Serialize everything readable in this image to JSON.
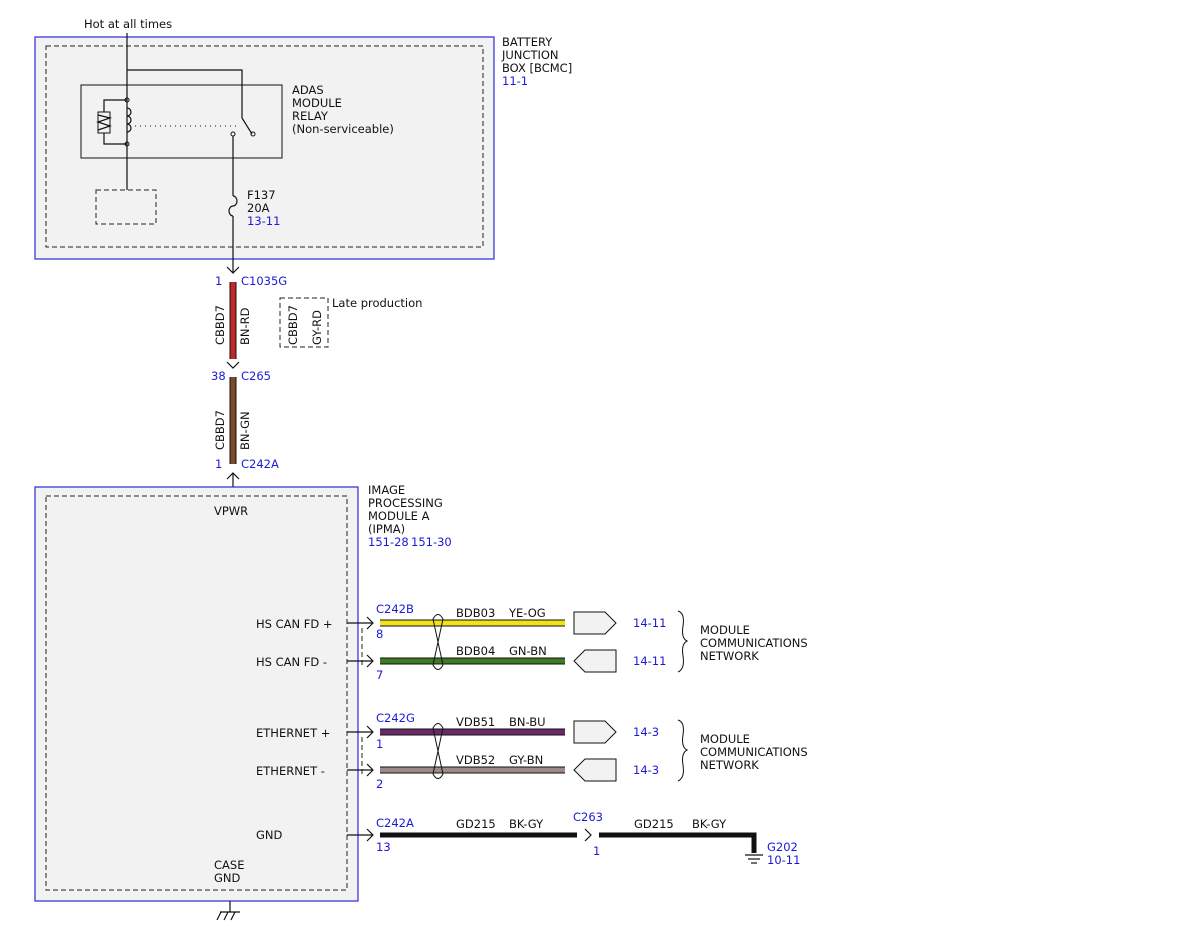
{
  "top": {
    "hot_label": "Hot at all times",
    "bjb_lines": [
      "BATTERY",
      "JUNCTION",
      "BOX [BCMC]"
    ],
    "bjb_ref": "11-1",
    "relay_lines": [
      "ADAS",
      "MODULE",
      "RELAY",
      "(Non-serviceable)"
    ],
    "fuse_name": "F137",
    "fuse_rating": "20A",
    "fuse_ref": "13-11"
  },
  "feed": {
    "c1_pin": "1",
    "c1_name": "C1035G",
    "wire1_circuit": "CBBD7",
    "wire1_color": "BN-RD",
    "wire1_hex": "#c0282c",
    "late_circuit": "CBBD7",
    "late_color": "GY-RD",
    "late_label": "Late production",
    "c2_pin": "38",
    "c2_name": "C265",
    "wire2_circuit": "CBBD7",
    "wire2_color": "BN-GN",
    "wire2_hex": "#7a4a2a",
    "c3_pin": "1",
    "c3_name": "C242A"
  },
  "module": {
    "title_lines": [
      "IMAGE",
      "PROCESSING",
      "MODULE A",
      "(IPMA)"
    ],
    "ref1": "151-28",
    "ref2": "151-30",
    "vpwr": "VPWR",
    "case_gnd_lines": [
      "CASE",
      "GND"
    ]
  },
  "signals": [
    {
      "label": "HS CAN FD +",
      "connector": "C242B",
      "pin": "8",
      "circuit": "BDB03",
      "color": "YE-OG",
      "ref": "14-11",
      "hex": "#f2e21a"
    },
    {
      "label": "HS CAN FD -",
      "connector": "",
      "pin": "7",
      "circuit": "BDB04",
      "color": "GN-BN",
      "ref": "14-11",
      "hex": "#3e7a28"
    },
    {
      "label": "ETHERNET +",
      "connector": "C242G",
      "pin": "1",
      "circuit": "VDB51",
      "color": "BN-BU",
      "ref": "14-3",
      "hex": "#6a2a6a"
    },
    {
      "label": "ETHERNET -",
      "connector": "",
      "pin": "2",
      "circuit": "VDB52",
      "color": "GY-BN",
      "ref": "14-3",
      "hex": "#9a8a88"
    }
  ],
  "network_label": [
    "MODULE",
    "COMMUNICATIONS",
    "NETWORK"
  ],
  "gnd": {
    "label": "GND",
    "connector": "C242A",
    "pin": "13",
    "circuit1": "GD215",
    "color1": "BK-GY",
    "inline_connector": "C263",
    "inline_pin": "1",
    "circuit2": "GD215",
    "color2": "BK-GY",
    "ground_name": "G202",
    "ground_ref": "10-11"
  }
}
